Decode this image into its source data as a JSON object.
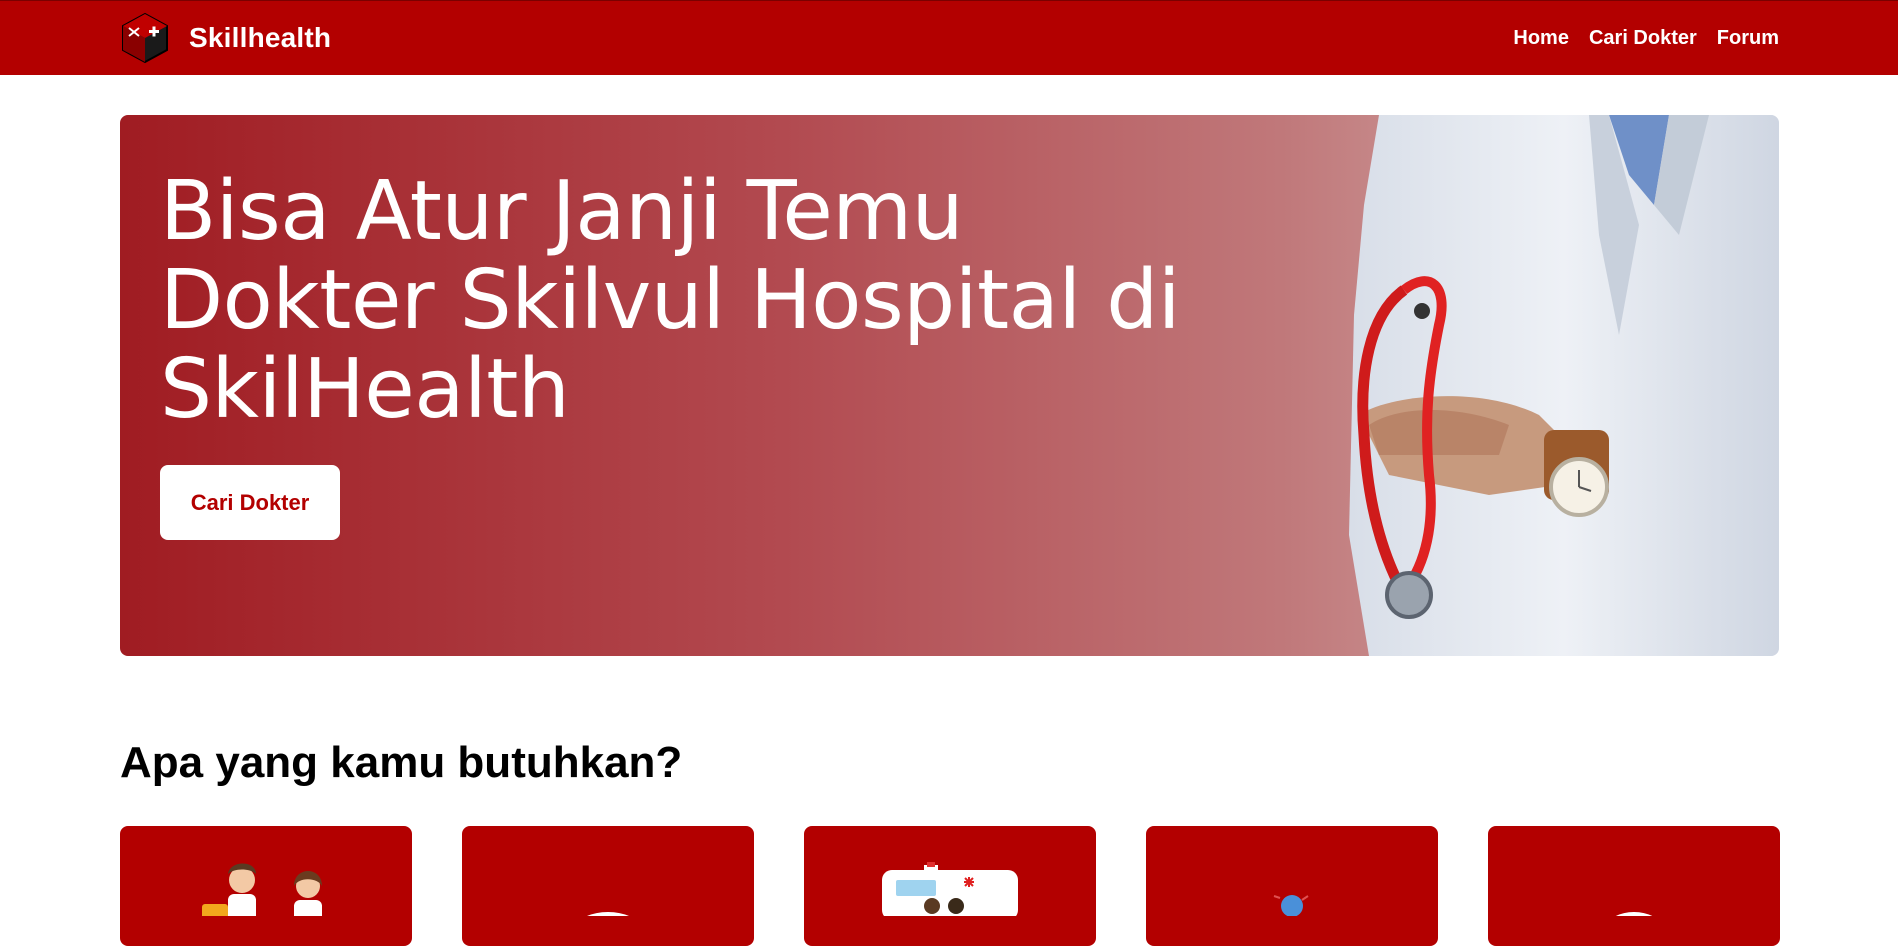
{
  "navbar": {
    "brand": "Skillhealth",
    "links": [
      {
        "label": "Home"
      },
      {
        "label": "Cari Dokter"
      },
      {
        "label": "Forum"
      }
    ]
  },
  "hero": {
    "title": "Bisa Atur Janji Temu Dokter Skilvul Hospital di SkilHealth",
    "button_label": "Cari Dokter"
  },
  "services": {
    "title": "Apa yang kamu butuhkan?",
    "cards": [
      {
        "icon": "doctors-illustration-icon"
      },
      {
        "icon": "consultation-icon"
      },
      {
        "icon": "ambulance-icon"
      },
      {
        "icon": "medical-icon"
      },
      {
        "icon": "service-icon"
      }
    ]
  },
  "colors": {
    "primary": "#b30000",
    "hero_gradient_start": "#a01c22",
    "white": "#ffffff"
  }
}
